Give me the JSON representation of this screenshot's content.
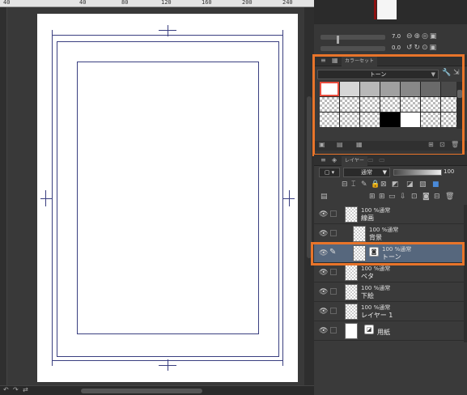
{
  "ruler": {
    "labels": [
      "40",
      "40",
      "80",
      "120",
      "160",
      "200",
      "240"
    ]
  },
  "canvas": {
    "page_color": "#ffffff",
    "guide_color": "#3a3f80"
  },
  "brush": {
    "size_value": "7.0",
    "opacity_value": "0.0"
  },
  "color_set": {
    "tab_label": "カラーセット",
    "set_name": "トーン",
    "swatches": [
      [
        "#ffffff",
        "#d6d6d6",
        "#b8b8b8",
        "#a0a0a0",
        "#888888",
        "#6a6a6a",
        "#4a4a4a"
      ],
      [
        "checker",
        "checker",
        "checker",
        "checker",
        "checker",
        "checker",
        "checker"
      ],
      [
        "checker",
        "checker",
        "checker",
        "#000000",
        "#ffffff",
        "checker",
        "checker"
      ]
    ]
  },
  "layer_panel": {
    "tab_label": "レイヤー",
    "blend_mode": "通常",
    "opacity": "100",
    "layers": [
      {
        "mode": "100 %通常",
        "name": "線画",
        "thumb": "checker",
        "selected": false,
        "child": false
      },
      {
        "mode": "100 %通常",
        "name": "背景",
        "thumb": "checker",
        "selected": false,
        "child": true
      },
      {
        "mode": "100 %通常",
        "name": "トーン",
        "thumb": "checker",
        "selected": true,
        "child": true
      },
      {
        "mode": "100 %通常",
        "name": "ベタ",
        "thumb": "checker",
        "selected": false,
        "child": false
      },
      {
        "mode": "100 %通常",
        "name": "下絵",
        "thumb": "checker",
        "selected": false,
        "child": false
      },
      {
        "mode": "100 %通常",
        "name": "レイヤー 1",
        "thumb": "checker",
        "selected": false,
        "child": false
      },
      {
        "mode": "",
        "name": "用紙",
        "thumb": "white",
        "selected": false,
        "child": false
      }
    ]
  },
  "colors": {
    "highlight": "#e8742a",
    "selected_layer": "#56677d",
    "selected_swatch": "#e84c3d"
  }
}
